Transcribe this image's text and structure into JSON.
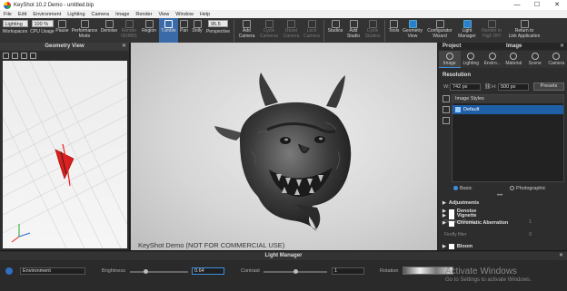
{
  "window": {
    "title": "KeyShot 10.2 Demo  -  untitled.bip",
    "minimize": "—",
    "maximize": "☐",
    "close": "✕"
  },
  "menu": [
    "File",
    "Edit",
    "Environment",
    "Lighting",
    "Camera",
    "Image",
    "Render",
    "View",
    "Window",
    "Help"
  ],
  "toolbar": {
    "workspace_value": "Lighting",
    "cpu_value": "100 %",
    "fov_value": "95.5",
    "buttons": [
      {
        "label": "Workspaces",
        "state": "normal"
      },
      {
        "label": "CPU Usage",
        "state": "normal"
      },
      {
        "label": "Pause",
        "state": "normal"
      },
      {
        "label": "Performance\nMode",
        "state": "normal"
      },
      {
        "label": "Denoise",
        "state": "normal"
      },
      {
        "label": "Render\nNURBS",
        "state": "dim"
      },
      {
        "label": "Region",
        "state": "normal"
      },
      {
        "label": "Tumble",
        "state": "active"
      },
      {
        "label": "Pan",
        "state": "normal"
      },
      {
        "label": "Dolly",
        "state": "normal"
      },
      {
        "label": "Perspective",
        "state": "normal"
      },
      {
        "label": "Add\nCamera",
        "state": "normal"
      },
      {
        "label": "Cycle\nCameras",
        "state": "dim"
      },
      {
        "label": "Reset\nCamera",
        "state": "dim"
      },
      {
        "label": "Lock\nCamera",
        "state": "dim"
      },
      {
        "label": "Studios",
        "state": "normal"
      },
      {
        "label": "Add\nStudio",
        "state": "normal"
      },
      {
        "label": "Cycle\nStudios",
        "state": "dim"
      },
      {
        "label": "Tools",
        "state": "normal"
      },
      {
        "label": "Geometry\nView",
        "state": "blue"
      },
      {
        "label": "Configurator\nWizard",
        "state": "normal"
      },
      {
        "label": "Light\nManager",
        "state": "blue"
      },
      {
        "label": "Render in\nHigh DPI",
        "state": "dim"
      },
      {
        "label": "Return to\nLink Application",
        "state": "normal"
      }
    ]
  },
  "geometry_view": {
    "title": "Geometry View",
    "close": "✕"
  },
  "viewport": {
    "watermark": "KeyShot Demo (NOT FOR COMMERCIAL USE)"
  },
  "right_panel": {
    "tabs": [
      "Project",
      "Image"
    ],
    "close": "✕",
    "subtabs": [
      "Image",
      "Lighting",
      "Enviro...",
      "Material",
      "Scene",
      "Camera"
    ],
    "resolution_label": "Resolution",
    "width_label": "W:",
    "width_value": "742 px",
    "height_label": "H:",
    "height_value": "500 px",
    "presets_label": "Presets",
    "image_styles_label": "Image Styles",
    "default_style": "Default",
    "mode_basic": "Basic",
    "mode_photographic": "Photographic",
    "dots": "•••",
    "adjustments": "Adjustments",
    "denoise": "Denoise",
    "denoise_blend_label": "Denoise Blend",
    "denoise_blend_value": "1",
    "firefly_filter_label": "Firefly filter",
    "firefly_filter_value": "0",
    "bloom": "Bloom",
    "vignette": "Vignette",
    "chromatic_aberration": "Chromatic Aberration"
  },
  "light_manager": {
    "title": "Light Manager",
    "close": "✕",
    "environment_value": "Environment",
    "brightness_label": "Brightness",
    "brightness_value": "0.64",
    "contrast_label": "Contrast",
    "contrast_value": "1",
    "rotation_label": "Rotation"
  },
  "os_overlay": {
    "line1": "Activate Windows",
    "line2": "Go to Settings to activate Windows."
  }
}
